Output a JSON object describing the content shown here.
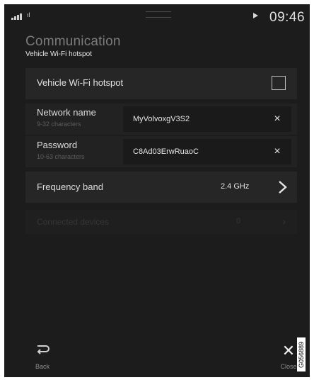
{
  "status_bar": {
    "left_text": "ıl",
    "clock": "09:46"
  },
  "header": {
    "section_title": "Communication",
    "page_title": "Vehicle Wi-Fi hotspot"
  },
  "settings": {
    "wifi_toggle": {
      "label": "Vehicle Wi-Fi hotspot",
      "checked": false
    },
    "network_name": {
      "label": "Network name",
      "hint": "9-32 characters",
      "value": "MyVolvoxgV3S2"
    },
    "password": {
      "label": "Password",
      "hint": "10-63 characters",
      "value": "C8Ad03ErwRuaoC"
    },
    "frequency_band": {
      "label": "Frequency band",
      "value": "2.4 GHz"
    },
    "connected_devices": {
      "label": "Connected devices",
      "count": "0"
    }
  },
  "footer": {
    "back_label": "Back",
    "close_label": "Close"
  },
  "figure_code": "G056889",
  "icons": {
    "signal": "signal-icon",
    "gps": "gps-arrow-icon",
    "clear": "clear-icon",
    "chevron": "chevron-right-icon",
    "back": "back-icon",
    "close": "close-icon"
  }
}
